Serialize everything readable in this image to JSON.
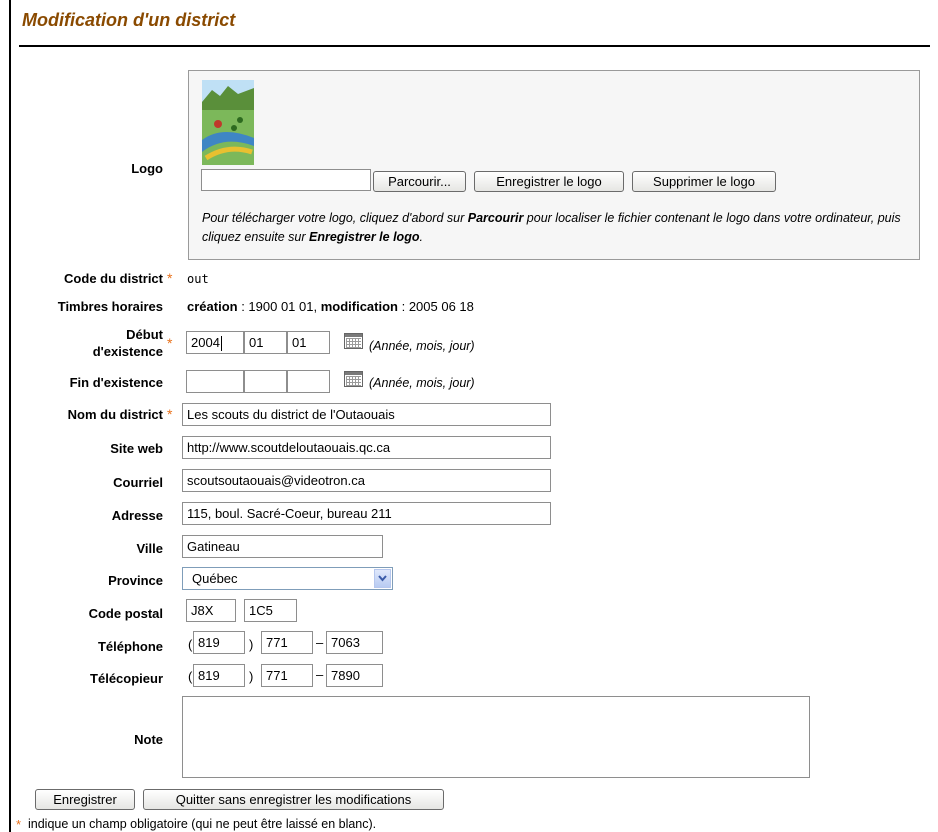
{
  "page_title": "Modification d'un district",
  "logo": {
    "label": "Logo",
    "browse_button": "Parcourir...",
    "save_button": "Enregistrer le logo",
    "delete_button": "Supprimer le logo",
    "help_1": "Pour télécharger votre logo, cliquez d'abord sur ",
    "help_browse": "Parcourir",
    "help_2": " pour localiser le fichier contenant le logo dans votre ordinateur, puis cliquez ensuite sur ",
    "help_save": "Enregistrer le logo",
    "help_3": "."
  },
  "code_district": {
    "label": "Code du district",
    "value": "out"
  },
  "timbres": {
    "label": "Timbres horaires",
    "creation_label": "création",
    "creation_value": " : 1900 01 01, ",
    "modification_label": "modification",
    "modification_value": " : 2005 06 18"
  },
  "debut": {
    "label_1": "Début",
    "label_2": "d'existence",
    "year": "2004",
    "month": "01",
    "day": "01",
    "hint": "(Année, mois, jour)"
  },
  "fin": {
    "label": "Fin d'existence",
    "year": "",
    "month": "",
    "day": "",
    "hint": "(Année, mois, jour)"
  },
  "nom": {
    "label": "Nom du district",
    "value": "Les scouts du district de l'Outaouais"
  },
  "site_web": {
    "label": "Site web",
    "value": "http://www.scoutdeloutaouais.qc.ca"
  },
  "courriel": {
    "label": "Courriel",
    "value": "scoutsoutaouais@videotron.ca"
  },
  "adresse": {
    "label": "Adresse",
    "value": "115, boul. Sacré-Coeur, bureau 211"
  },
  "ville": {
    "label": "Ville",
    "value": "Gatineau"
  },
  "province": {
    "label": "Province",
    "value": "Québec"
  },
  "code_postal": {
    "label": "Code postal",
    "part1": "J8X",
    "part2": "1C5"
  },
  "telephone": {
    "label": "Téléphone",
    "area": "819",
    "exchange": "771",
    "number": "7063"
  },
  "telecopieur": {
    "label": "Télécopieur",
    "area": "819",
    "exchange": "771",
    "number": "7890"
  },
  "note": {
    "label": "Note",
    "value": ""
  },
  "buttons": {
    "save": "Enregistrer",
    "quit": "Quitter sans enregistrer les modifications"
  },
  "footer": {
    "star": "*",
    "text": "indique un champ obligatoire (qui ne peut être laissé en blanc)."
  },
  "punct": {
    "open_paren": "(",
    "close_paren": ")",
    "dash": "–",
    "required_star": "*"
  },
  "colors": {
    "title": "#8a4a00",
    "required": "#e8701a"
  }
}
